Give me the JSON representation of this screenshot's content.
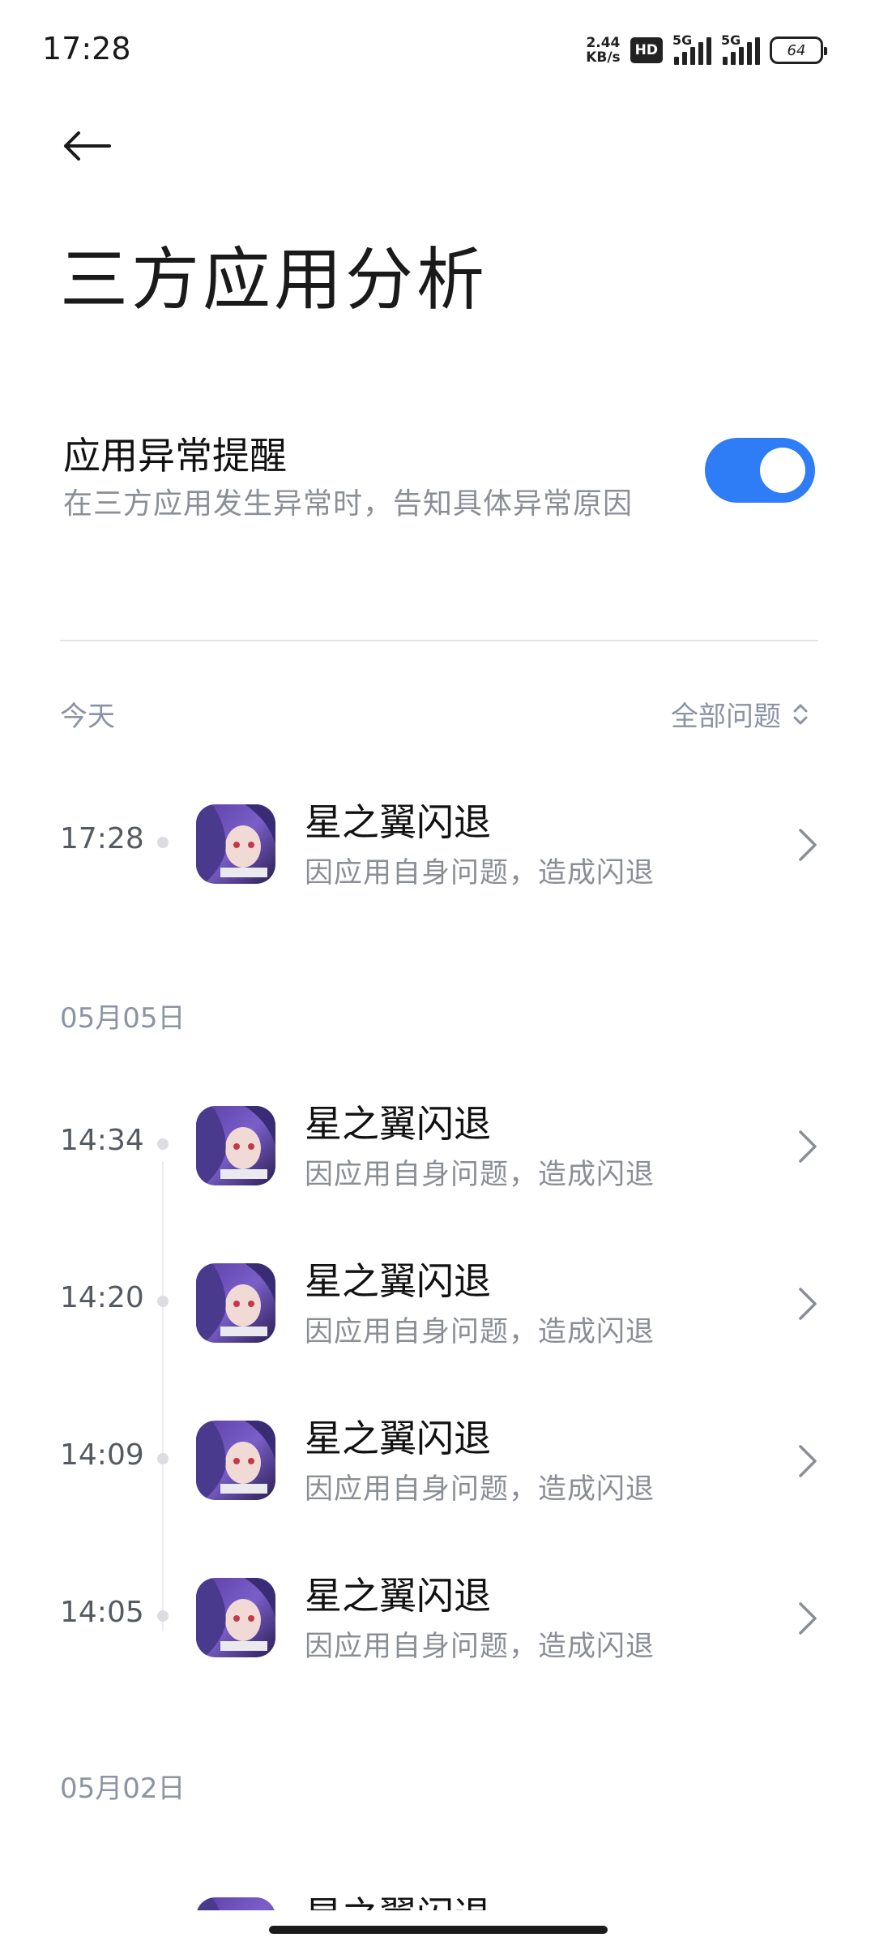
{
  "status_bar": {
    "time": "17:28",
    "net_speed_value": "2.44",
    "net_speed_unit": "KB/s",
    "hd_badge": "HD",
    "sim1": "5G",
    "sim2": "5G",
    "battery": "64"
  },
  "header": {
    "back_icon": "arrow-left-icon",
    "title": "三方应用分析"
  },
  "setting": {
    "title": "应用异常提醒",
    "subtitle": "在三方应用发生异常时，告知具体异常原因",
    "enabled": true,
    "accent_color": "#2e7cf6"
  },
  "filter": {
    "label": "全部问题",
    "icon": "sort-updown-icon"
  },
  "groups": [
    {
      "label": "今天",
      "items": [
        {
          "time": "17:28",
          "title": "星之翼闪退",
          "subtitle": "因应用自身问题，造成闪退"
        }
      ]
    },
    {
      "label": "05月05日",
      "items": [
        {
          "time": "14:34",
          "title": "星之翼闪退",
          "subtitle": "因应用自身问题，造成闪退"
        },
        {
          "time": "14:20",
          "title": "星之翼闪退",
          "subtitle": "因应用自身问题，造成闪退"
        },
        {
          "time": "14:09",
          "title": "星之翼闪退",
          "subtitle": "因应用自身问题，造成闪退"
        },
        {
          "time": "14:05",
          "title": "星之翼闪退",
          "subtitle": "因应用自身问题，造成闪退"
        }
      ]
    },
    {
      "label": "05月02日",
      "items": [
        {
          "time": "",
          "title": "星之翼闪退",
          "subtitle": ""
        }
      ]
    }
  ]
}
